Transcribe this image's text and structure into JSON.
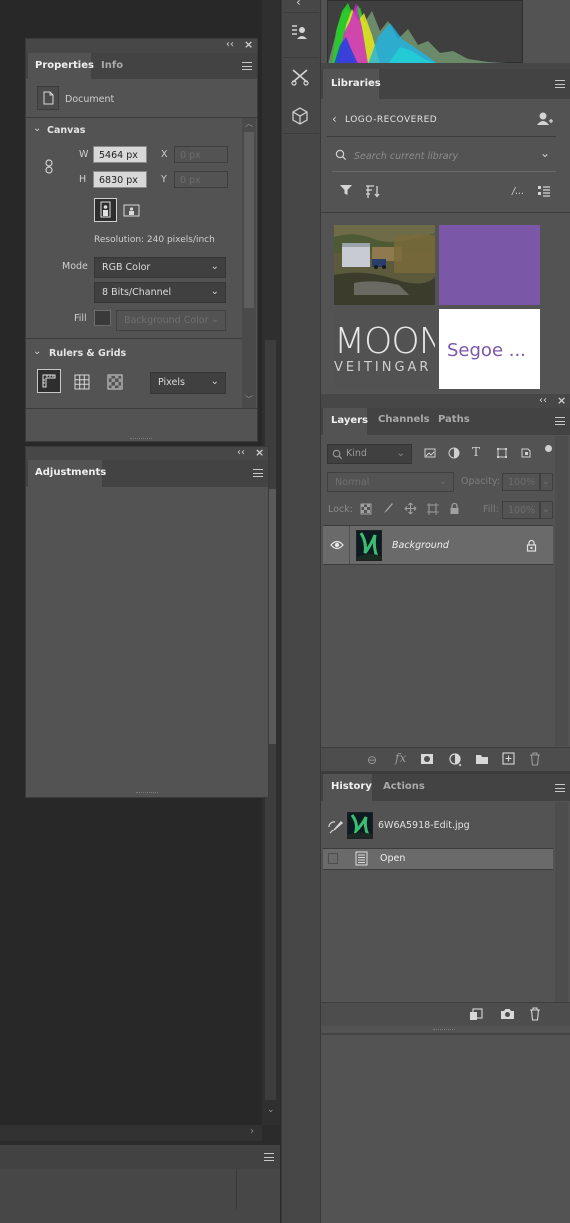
{
  "properties_panel": {
    "tabs": [
      {
        "label": "Properties"
      },
      {
        "label": "Info"
      }
    ],
    "doc_label": "Document",
    "canvas_section": "Canvas",
    "w_label": "W",
    "w_value": "5464 px",
    "h_label": "H",
    "h_value": "6830 px",
    "x_label": "X",
    "x_value": "0 px",
    "y_label": "Y",
    "y_value": "0 px",
    "resolution": "Resolution: 240 pixels/inch",
    "mode_label": "Mode",
    "mode_value": "RGB Color",
    "bits_value": "8 Bits/Channel",
    "fill_label": "Fill",
    "fill_value": "Background Color",
    "rulers_section": "Rulers & Grids",
    "units_value": "Pixels"
  },
  "adjustments_panel": {
    "tab": "Adjustments"
  },
  "libraries_panel": {
    "tab": "Libraries",
    "library_name": "LOGO-RECOVERED",
    "search_placeholder": "Search current library",
    "sort_icon_text": "/...",
    "items": [
      {
        "kind": "photo"
      },
      {
        "kind": "color",
        "color": "#7b57a8"
      },
      {
        "kind": "logo",
        "line1": "MOON",
        "line2": "VEITINGAR"
      },
      {
        "kind": "char_style",
        "text": "Segoe ..."
      }
    ]
  },
  "layers_panel": {
    "tabs": [
      {
        "label": "Layers"
      },
      {
        "label": "Channels"
      },
      {
        "label": "Paths"
      }
    ],
    "kind_placeholder": "Kind",
    "blend_mode": "Normal",
    "opacity_label": "Opacity:",
    "opacity_value": "100%",
    "lock_label": "Lock:",
    "fill_label": "Fill:",
    "fill_value": "100%",
    "layers": [
      {
        "name": "Background"
      }
    ]
  },
  "history_panel": {
    "tabs": [
      {
        "label": "History"
      },
      {
        "label": "Actions"
      }
    ],
    "snapshot_name": "6W6A5918-Edit.jpg",
    "states": [
      {
        "name": "Open"
      }
    ]
  },
  "colors": {
    "panel_bg": "#535353",
    "panel_dark": "#474747",
    "workspace": "#2b2b2b",
    "accent_purple": "#7b57a8"
  }
}
